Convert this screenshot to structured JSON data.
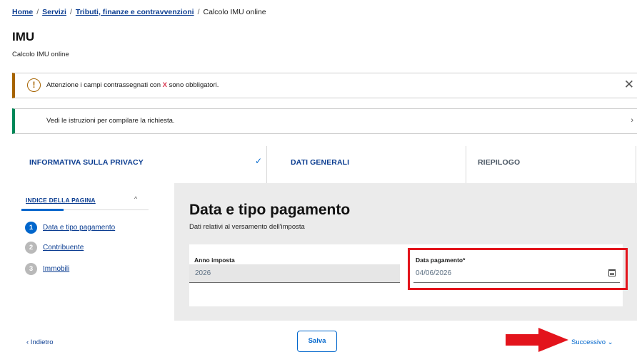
{
  "breadcrumb": {
    "items": [
      "Home",
      "Servizi",
      "Tributi, finanze e contravvenzioni"
    ],
    "current": "Calcolo IMU online",
    "separator": "/"
  },
  "page": {
    "title": "IMU",
    "subtitle": "Calcolo IMU online"
  },
  "alerts": {
    "warning": {
      "text_before": "Attenzione i campi contrassegnati con ",
      "mark": "X",
      "text_after": " sono obbligatori.",
      "icon_glyph": "!",
      "close_glyph": "✕"
    },
    "info": {
      "text": "Vedi le istruzioni per compilare la richiesta.",
      "chevron_glyph": "›"
    }
  },
  "stepper": {
    "steps": [
      {
        "label": "INFORMATIVA SULLA PRIVACY",
        "state": "completed",
        "check_glyph": "✓"
      },
      {
        "label": "DATI GENERALI",
        "state": "active"
      },
      {
        "label": "RIEPILOGO",
        "state": "pending"
      }
    ]
  },
  "toc": {
    "title": "INDICE DELLA PAGINA",
    "caret_glyph": "^",
    "progress_fraction": 0.33,
    "items": [
      {
        "num": "1",
        "label": "Data e tipo pagamento",
        "active": true
      },
      {
        "num": "2",
        "label": "Contribuente",
        "active": false
      },
      {
        "num": "3",
        "label": "Immobili",
        "active": false
      }
    ]
  },
  "form": {
    "section_title": "Data e tipo pagamento",
    "section_description": "Dati relativi al versamento dell'imposta",
    "anno_imposta": {
      "label": "Anno imposta",
      "value": "2026"
    },
    "data_pagamento": {
      "label": "Data pagamento*",
      "value": "04/06/2026"
    }
  },
  "nav": {
    "back_label": "‹  Indietro",
    "save_label": "Salva",
    "next_label": "Successivo ⌄"
  },
  "colors": {
    "primary": "#0066cc",
    "link": "#0b3d91",
    "warning": "#a66300",
    "success": "#008758",
    "highlight": "#e3141c",
    "required_mark": "#d9364f"
  }
}
